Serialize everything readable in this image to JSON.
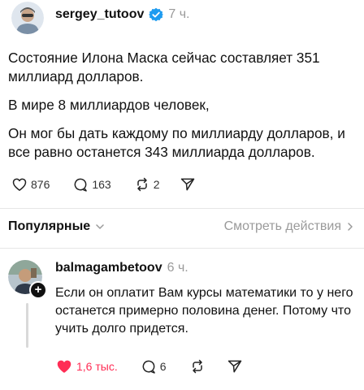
{
  "post": {
    "username": "sergey_tutoov",
    "time": "7 ч.",
    "paragraphs": [
      "Состояние Илона Маска сейчас составляет 351 миллиард долларов.",
      "В мире 8 миллиардов человек,",
      "Он мог бы дать каждому по миллиарду долларов, и все равно останется 343 миллиарда долларов."
    ],
    "likes": "876",
    "comments": "163",
    "reposts": "2"
  },
  "replies_section": {
    "filter_label": "Популярные",
    "activity_link": "Смотреть действия"
  },
  "reply": {
    "username": "balmagambetoov",
    "time": "6 ч.",
    "text": "Если он оплатит Вам курсы математики то у него останется примерно половина денег. Потому что учить долго придется.",
    "likes": "1,6 тыс.",
    "comments": "6",
    "plus": "+"
  },
  "colors": {
    "verified": "#1d9bf0",
    "like_active": "#ff2d55",
    "muted_text": "#9a9a9a"
  },
  "icons": {
    "like": "heart-icon",
    "comment": "comment-bubble-icon",
    "repost": "repost-icon",
    "share": "send-icon",
    "verified": "verified-badge-icon",
    "chevron": "chevron-down-icon",
    "arrow": "chevron-right-icon"
  }
}
